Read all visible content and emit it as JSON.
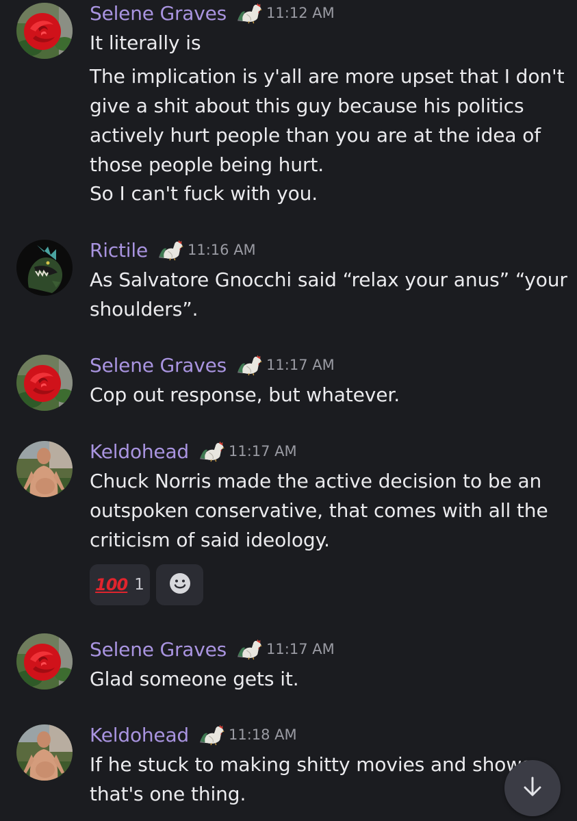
{
  "colors": {
    "background": "#1b1c20",
    "username": "#a994e0",
    "text": "#ebebee",
    "timestamp": "#9a9ba3",
    "reaction_bg": "#2b2c33"
  },
  "messages": [
    {
      "author": "Selene Graves",
      "avatar_icon": "red-rose-avatar",
      "role_icon": "rooster-icon",
      "time": "11:12 AM",
      "lines": [
        "It literally is",
        "The implication is y'all are more upset that I don't",
        "give a shit about this guy because his politics",
        "actively hurt people than you are at the idea of",
        "those people being hurt.",
        "So I can't fuck with you."
      ]
    },
    {
      "author": "Rictile",
      "avatar_icon": "green-dinosaur-avatar",
      "role_icon": "rooster-icon",
      "time": "11:16 AM",
      "lines": [
        "As Salvatore Gnocchi said “relax your anus” “your",
        "shoulders”."
      ]
    },
    {
      "author": "Selene Graves",
      "avatar_icon": "red-rose-avatar",
      "role_icon": "rooster-icon",
      "time": "11:17 AM",
      "lines": [
        "Cop out response, but whatever."
      ]
    },
    {
      "author": "Keldohead",
      "avatar_icon": "shirtless-man-avatar",
      "role_icon": "rooster-icon",
      "time": "11:17 AM",
      "lines": [
        "Chuck Norris made the active decision to be an",
        "outspoken conservative, that comes with all the",
        "criticism of said ideology."
      ],
      "reaction": {
        "emoji_icon": "hundred-points-icon",
        "emoji_text": "100",
        "count": "1",
        "add_icon": "add-reaction-smiley-icon"
      }
    },
    {
      "author": "Selene Graves",
      "avatar_icon": "red-rose-avatar",
      "role_icon": "rooster-icon",
      "time": "11:17 AM",
      "lines": [
        "Glad someone gets it."
      ]
    },
    {
      "author": "Keldohead",
      "avatar_icon": "shirtless-man-avatar",
      "role_icon": "rooster-icon",
      "time": "11:18 AM",
      "lines": [
        "If he stuck to making shitty movies and shows",
        "that's one thing."
      ]
    }
  ],
  "jump_to_present": {
    "icon": "arrow-down-icon"
  }
}
